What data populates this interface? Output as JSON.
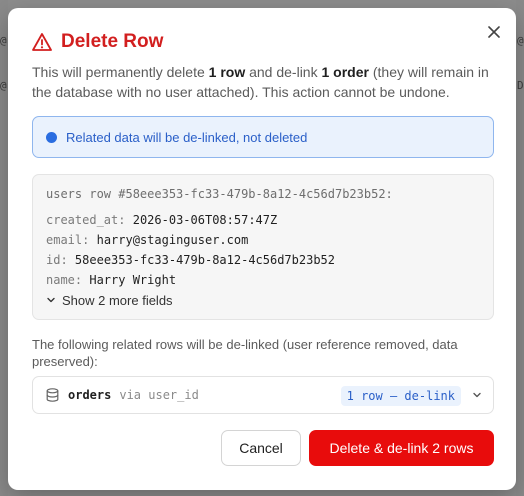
{
  "background": {
    "left_chars": [
      "@",
      "@"
    ],
    "right_chars": [
      "@",
      "D"
    ]
  },
  "dialog": {
    "title": "Delete Row",
    "description": {
      "part1": "This will permanently delete ",
      "bold1": "1 row",
      "part2": " and de-link ",
      "bold2": "1 order",
      "part3": " (they will remain in the database with no user attached). This action cannot be undone."
    },
    "info_banner": "Related data will be de-linked, not deleted",
    "record": {
      "header": "users row #58eee353-fc33-479b-8a12-4c56d7b23b52:",
      "fields": [
        {
          "key": "created_at:",
          "value": "2026-03-06T08:57:47Z"
        },
        {
          "key": "email:",
          "value": "harry@staginguser.com"
        },
        {
          "key": "id:",
          "value": "58eee353-fc33-479b-8a12-4c56d7b23b52"
        },
        {
          "key": "name:",
          "value": "Harry Wright"
        }
      ],
      "show_more": "Show 2 more fields"
    },
    "related_label": "The following related rows will be de-linked (user reference removed, data preserved):",
    "related": {
      "table": "orders",
      "via": "via user_id",
      "badge": "1 row — de-link"
    },
    "buttons": {
      "cancel": "Cancel",
      "delete": "Delete & de-link 2 rows"
    }
  },
  "colors": {
    "danger": "#d21f1f",
    "delete_button": "#e80c0c",
    "info_bg": "#eaf2fd",
    "info_text": "#2a5fc8"
  },
  "icons": [
    "warning-triangle-icon",
    "close-icon",
    "info-dot-icon",
    "chevron-down-icon",
    "database-icon"
  ]
}
